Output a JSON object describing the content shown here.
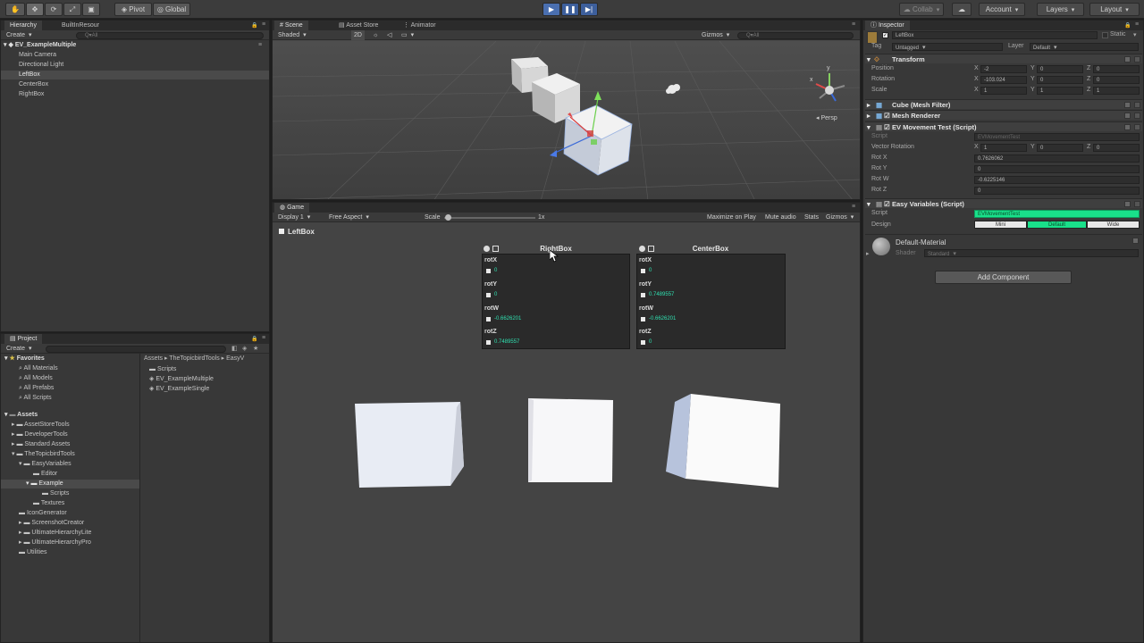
{
  "toolbar": {
    "pivot": "Pivot",
    "global": "Global",
    "collab": "Collab",
    "account": "Account",
    "layers": "Layers",
    "layout": "Layout"
  },
  "hierarchy": {
    "tabs": [
      "Hierarchy",
      "BuiltInResour"
    ],
    "create": "Create",
    "search_placeholder": "Q▾All",
    "scene_name": "EV_ExampleMultiple",
    "items": [
      "Main Camera",
      "Directional Light",
      "LeftBox",
      "CenterBox",
      "RightBox"
    ]
  },
  "scene": {
    "tabs": [
      "Scene",
      "Asset Store",
      "Animator"
    ],
    "shading": "Shaded",
    "mode_2d": "2D",
    "gizmos": "Gizmos",
    "search_placeholder": "Q▾All",
    "persp": "Persp",
    "gizmo_y": "y",
    "gizmo_x": "x"
  },
  "game": {
    "tab": "Game",
    "display": "Display 1",
    "aspect": "Free Aspect",
    "scale_label": "Scale",
    "scale_value": "1x",
    "buttons": [
      "Maximize on Play",
      "Mute audio",
      "Stats",
      "Gizmos"
    ],
    "left_label": "LeftBox",
    "boxes": [
      {
        "title": "RightBox",
        "fields": [
          {
            "name": "rotX",
            "value": "0"
          },
          {
            "name": "rotY",
            "value": "0"
          },
          {
            "name": "rotW",
            "value": "-0.6626201"
          },
          {
            "name": "rotZ",
            "value": "0.7489557"
          }
        ]
      },
      {
        "title": "CenterBox",
        "fields": [
          {
            "name": "rotX",
            "value": "0"
          },
          {
            "name": "rotY",
            "value": "0.7489557"
          },
          {
            "name": "rotW",
            "value": "-0.6626201"
          },
          {
            "name": "rotZ",
            "value": "0"
          }
        ]
      }
    ]
  },
  "project": {
    "tab": "Project",
    "create": "Create",
    "favorites_title": "Favorites",
    "favorites": [
      "All Materials",
      "All Models",
      "All Prefabs",
      "All Scripts"
    ],
    "assets_title": "Assets",
    "tree": [
      "AssetStoreTools",
      "DeveloperTools",
      "Standard Assets",
      "TheTopicbirdTools",
      "EasyVariables",
      "Editor",
      "Example",
      "Scripts",
      "Textures",
      "IconGenerator",
      "ScreenshotCreator",
      "UltimateHierarchyLite",
      "UltimateHierarchyPro",
      "Utilities"
    ],
    "breadcrumb": [
      "Assets",
      "TheTopicbirdTools",
      "EasyV"
    ],
    "files": [
      "Scripts",
      "EV_ExampleMultiple",
      "EV_ExampleSingle"
    ]
  },
  "inspector": {
    "tab": "Inspector",
    "object_name": "LeftBox",
    "static_label": "Static",
    "tag_label": "Tag",
    "tag_value": "Untagged",
    "layer_label": "Layer",
    "layer_value": "Default",
    "transform": {
      "title": "Transform",
      "position_label": "Position",
      "rotation_label": "Rotation",
      "scale_label": "Scale",
      "position": [
        "-2",
        "0",
        "0"
      ],
      "rotation": [
        "-103.024",
        "0",
        "0"
      ],
      "scale": [
        "1",
        "1",
        "1"
      ],
      "axes": [
        "X",
        "Y",
        "Z"
      ]
    },
    "mesh_filter": "Cube (Mesh Filter)",
    "mesh_renderer": "Mesh Renderer",
    "movement": {
      "title": "EV Movement Test (Script)",
      "script_label": "Script",
      "script_value": "EVMovementTest",
      "vector_label": "Vector Rotation",
      "vector": [
        "1",
        "0",
        "0"
      ],
      "rows": [
        {
          "label": "Rot X",
          "value": "0.7626062"
        },
        {
          "label": "Rot Y",
          "value": "0"
        },
        {
          "label": "Rot W",
          "value": "-0.6225146"
        },
        {
          "label": "Rot Z",
          "value": "0"
        }
      ]
    },
    "easy": {
      "title": "Easy Variables (Script)",
      "script_label": "Script",
      "script_value": "EVMovementTest",
      "design_label": "Design",
      "design_options": [
        "Mini",
        "Default",
        "Wide"
      ],
      "selected_design": "Default"
    },
    "material": {
      "name": "Default-Material",
      "shader_label": "Shader",
      "shader_value": "Standard"
    },
    "add_component": "Add Component"
  },
  "colors": {
    "accent_green": "#19e08a",
    "value_teal": "#2fe0b0",
    "play_blue": "#4a6fb0"
  }
}
